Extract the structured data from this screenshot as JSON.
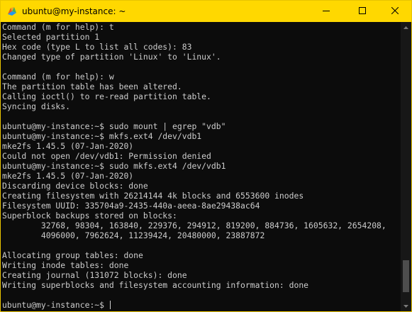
{
  "window": {
    "title": "ubuntu@my-instance: ~",
    "app_icon": "linux-penguin-icon",
    "accent_color": "#ffd800",
    "controls": {
      "minimize": "minimize-icon",
      "maximize": "maximize-icon",
      "close": "close-icon"
    }
  },
  "terminal": {
    "background": "#0c0c0c",
    "foreground": "#cccccc",
    "lines": [
      "Command (m for help): t",
      "Selected partition 1",
      "Hex code (type L to list all codes): 83",
      "Changed type of partition 'Linux' to 'Linux'.",
      "",
      "Command (m for help): w",
      "The partition table has been altered.",
      "Calling ioctl() to re-read partition table.",
      "Syncing disks.",
      "",
      "ubuntu@my-instance:~$ sudo mount | egrep \"vdb\"",
      "ubuntu@my-instance:~$ mkfs.ext4 /dev/vdb1",
      "mke2fs 1.45.5 (07-Jan-2020)",
      "Could not open /dev/vdb1: Permission denied",
      "ubuntu@my-instance:~$ sudo mkfs.ext4 /dev/vdb1",
      "mke2fs 1.45.5 (07-Jan-2020)",
      "Discarding device blocks: done",
      "Creating filesystem with 26214144 4k blocks and 6553600 inodes",
      "Filesystem UUID: 335704a9-2435-440a-aeea-8ae29438ac64",
      "Superblock backups stored on blocks:",
      "        32768, 98304, 163840, 229376, 294912, 819200, 884736, 1605632, 2654208,",
      "        4096000, 7962624, 11239424, 20480000, 23887872",
      "",
      "Allocating group tables: done",
      "Writing inode tables: done",
      "Creating journal (131072 blocks): done",
      "Writing superblocks and filesystem accounting information: done",
      "",
      "ubuntu@my-instance:~$ "
    ],
    "prompt_line_index": 28
  },
  "scrollbar": {
    "position_fraction": 0.97,
    "visible_fraction": 0.12
  }
}
